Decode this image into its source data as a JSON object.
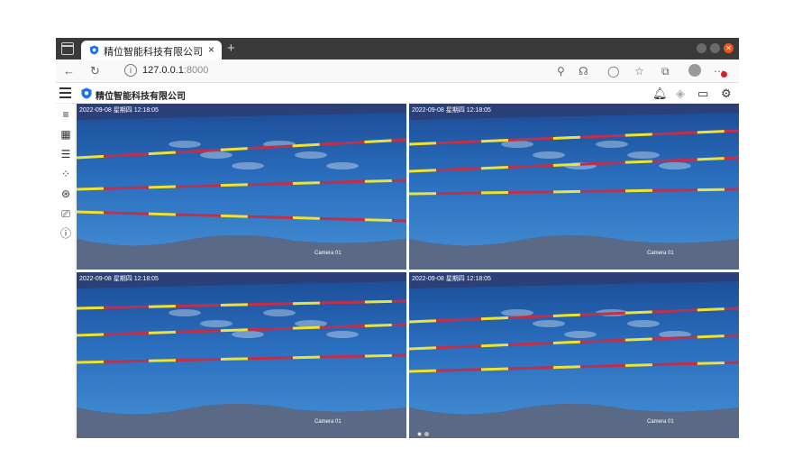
{
  "browser": {
    "tab_title": "精位智能科技有限公司",
    "tab_close": "×",
    "new_tab": "+",
    "url_host": "127.0.0.1",
    "url_port": ":8000"
  },
  "app": {
    "title": "精位智能科技有限公司"
  },
  "cameras": [
    {
      "timestamp": "2022-09-08 星期四 12:18:05",
      "label": "Camera 01"
    },
    {
      "timestamp": "2022-09-08 星期四 12:18:05",
      "label": "Camera 01"
    },
    {
      "timestamp": "2022-09-08 星期四 12:18:05",
      "label": "Camera 01"
    },
    {
      "timestamp": "2022-09-08 星期四 12:18:05",
      "label": "Camera 01"
    }
  ],
  "icons": {
    "tab": "shield-icon",
    "sidebar": [
      "database-icon",
      "grid-icon",
      "sliders-icon",
      "focus-icon",
      "settings-wheel-icon",
      "camera-icon",
      "info-icon"
    ],
    "header": [
      "bell-icon",
      "diamond-icon",
      "video-icon",
      "gear-icon"
    ]
  },
  "colors": {
    "titlebar": "#3a3a3a",
    "brand": "#1a73e8",
    "pool_water": "#2a6fbe",
    "pool_deck": "#5a6a86",
    "lane_red": "#c0304a",
    "lane_yellow": "#e7e43a"
  }
}
